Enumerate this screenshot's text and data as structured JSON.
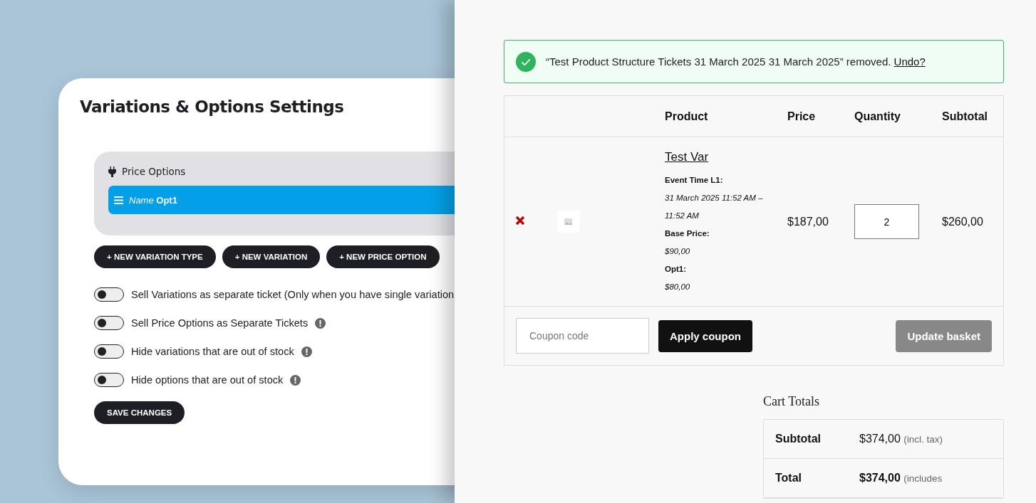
{
  "settings": {
    "title": "Variations & Options Settings",
    "price_options": {
      "label": "Price Options",
      "items": [
        {
          "label": "Name",
          "value": "Opt1"
        }
      ]
    },
    "buttons": [
      "+ NEW VARIATION TYPE",
      "+ NEW VARIATION",
      "+ NEW PRICE OPTION"
    ],
    "toggles": [
      {
        "label": "Sell Variations as separate ticket (Only when you have single variation",
        "on": false
      },
      {
        "label": "Sell Price Options as Separate Tickets",
        "on": false
      },
      {
        "label": "Hide variations that are out of stock",
        "on": false
      },
      {
        "label": "Hide options that are out of stock",
        "on": false
      }
    ],
    "save_button": "SAVE CHANGES"
  },
  "cart": {
    "notice": {
      "message": "“Test Product Structure Tickets 31 March 2025 31 March 2025” removed.",
      "link": "Undo?"
    },
    "columns": [
      "Product",
      "Price",
      "Quantity",
      "Subtotal"
    ],
    "rows": [
      {
        "name": "Test Var",
        "meta": [
          {
            "label": "Event Time L1:",
            "value": "31 March 2025 11:52 AM – 11:52 AM"
          },
          {
            "label": "Base Price:",
            "value": "$90,00"
          },
          {
            "label": "Opt1:",
            "value": "$80,00"
          }
        ],
        "price": "$187,00",
        "quantity": "2",
        "subtotal": "$260,00"
      }
    ],
    "coupon": {
      "placeholder": "Coupon code",
      "apply": "Apply coupon",
      "update": "Update basket",
      "update_disabled": true
    },
    "totals": {
      "title": "Cart Totals",
      "rows": [
        {
          "label": "Subtotal",
          "amount": "$374,00",
          "note": "(incl. tax)",
          "kind": "subtotal"
        },
        {
          "label": "Total",
          "amount": "$374,00",
          "note": "(includes",
          "kind": "total"
        }
      ]
    }
  }
}
